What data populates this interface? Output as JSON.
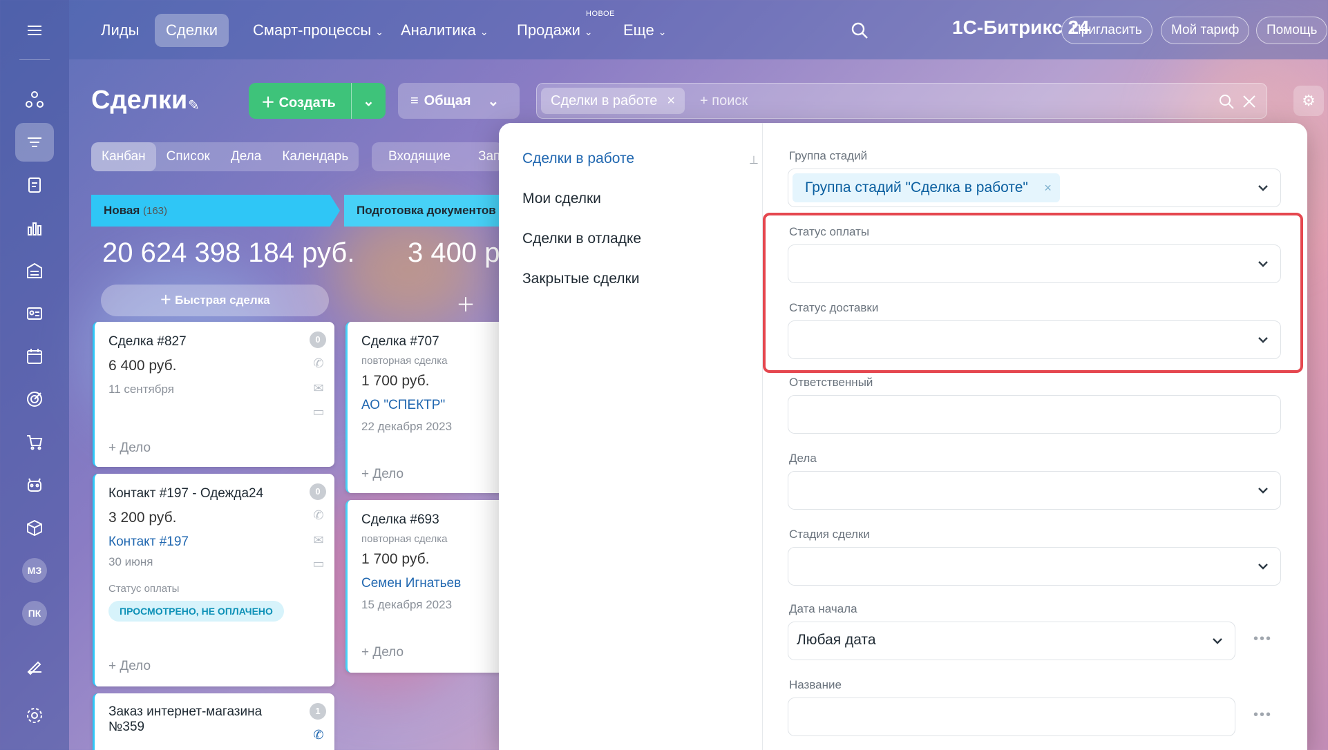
{
  "topnav": {
    "items": [
      {
        "label": "Лиды"
      },
      {
        "label": "Сделки"
      },
      {
        "label": "Смарт-процессы"
      },
      {
        "label": "Аналитика"
      },
      {
        "label": "Продажи"
      },
      {
        "label": "Еще"
      }
    ],
    "new_badge": "НОВОЕ",
    "logo": "1С-Битрикс 24",
    "invite": "Пригласить",
    "tariff": "Мой тариф",
    "help": "Помощь"
  },
  "rail": {
    "user1": "МЗ",
    "user2": "ПК"
  },
  "header": {
    "title": "Сделки",
    "create": "Создать",
    "general": "Общая",
    "search_chip": "Сделки в работе",
    "search_placeholder": "+ поиск"
  },
  "views": {
    "tabs": [
      "Канбан",
      "Список",
      "Дела",
      "Календарь"
    ],
    "incoming": "Входящие",
    "cut": "Зап"
  },
  "kanban": {
    "col1": {
      "title": "Новая",
      "count": "(163)",
      "sum": "20 624 398 184 руб.",
      "quick": "Быстрая сделка"
    },
    "col2": {
      "title": "Подготовка документов",
      "sum": "3 400 ру"
    },
    "cards": {
      "c827": {
        "title": "Сделка #827",
        "price": "6 400 руб.",
        "date": "11 сентября",
        "badge": "0",
        "action": "+ Дело"
      },
      "c197": {
        "title": "Контакт #197 - Одежда24",
        "price": "3 200 руб.",
        "link": "Контакт #197",
        "date": "30 июня",
        "status_label": "Статус оплаты",
        "status": "ПРОСМОТРЕНО, НЕ ОПЛАЧЕНО",
        "badge": "0",
        "action": "+ Дело"
      },
      "c359": {
        "title1": "Заказ интернет-магазина",
        "title2": "№359",
        "badge": "1"
      },
      "c707": {
        "title": "Сделка #707",
        "sub": "повторная сделка",
        "price": "1 700 руб.",
        "link": "АО \"СПЕКТР\"",
        "date": "22 декабря 2023",
        "action": "+ Дело"
      },
      "c693": {
        "title": "Сделка #693",
        "sub": "повторная сделка",
        "price": "1 700 руб.",
        "link": "Семен Игнатьев",
        "date": "15 декабря 2023",
        "action": "+ Дело"
      }
    }
  },
  "filter": {
    "presets": [
      "Сделки в работе",
      "Мои сделки",
      "Сделки в отладке",
      "Закрытые сделки"
    ],
    "fields": {
      "stage_group": {
        "label": "Группа стадий",
        "tag": "Группа стадий \"Сделка в работе\""
      },
      "pay_status": {
        "label": "Статус оплаты"
      },
      "delivery_status": {
        "label": "Статус доставки"
      },
      "responsible": {
        "label": "Ответственный"
      },
      "tasks": {
        "label": "Дела"
      },
      "deal_stage": {
        "label": "Стадия сделки"
      },
      "start_date": {
        "label": "Дата начала",
        "value": "Любая дата"
      },
      "name": {
        "label": "Название"
      }
    }
  },
  "colors": {
    "accent": "#2067b0",
    "create": "#3ec37a",
    "highlight": "#e5474f",
    "column": "#2fc6f6"
  }
}
